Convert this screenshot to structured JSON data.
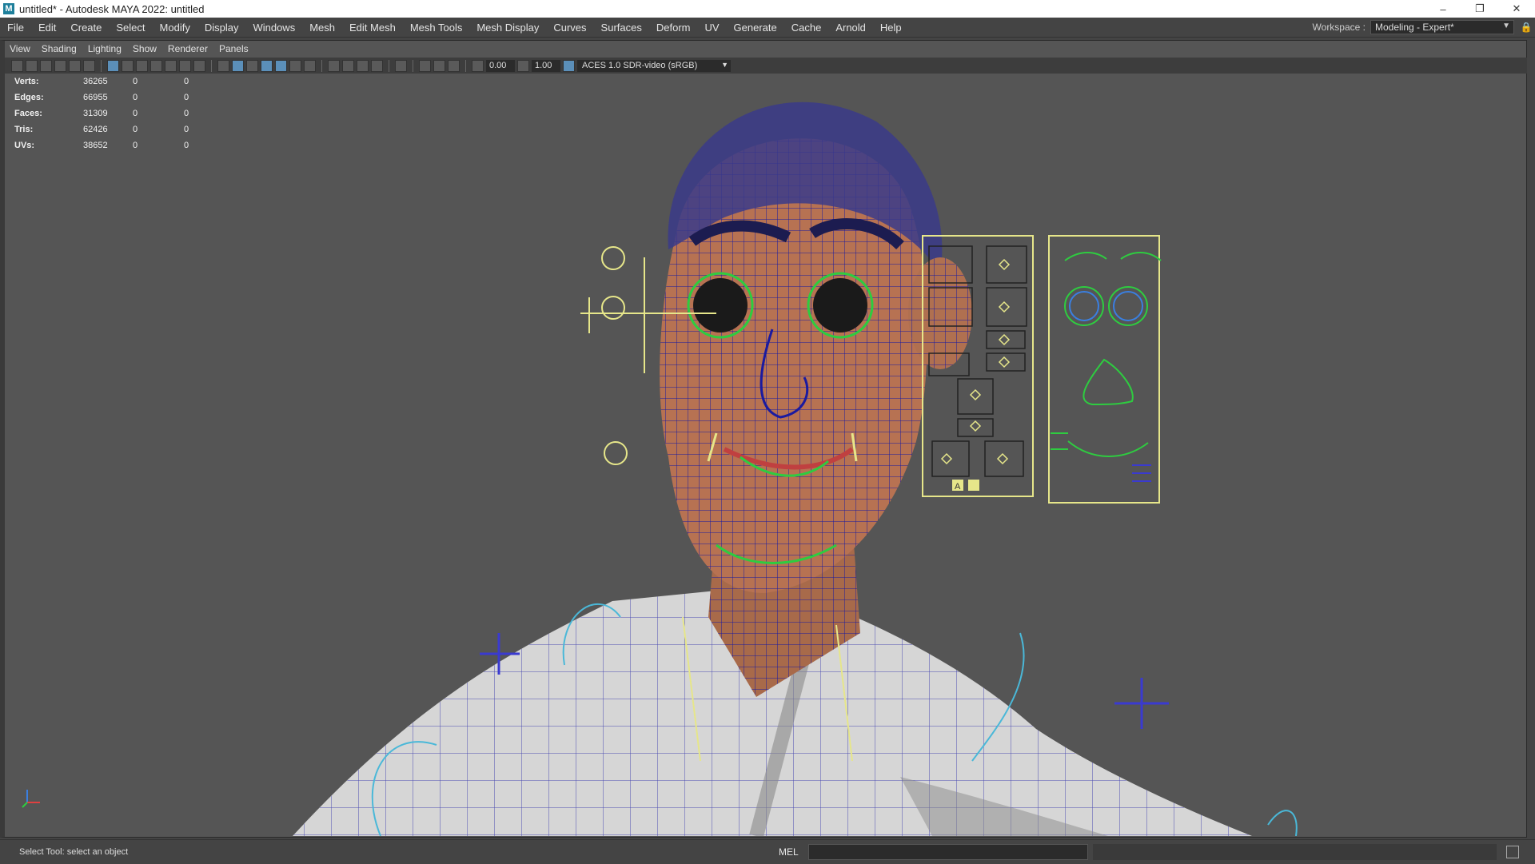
{
  "window": {
    "title": "untitled* - Autodesk MAYA 2022: untitled",
    "app_icon": "M",
    "controls": [
      "–",
      "❐",
      "✕"
    ]
  },
  "menubar": {
    "items": [
      "File",
      "Edit",
      "Create",
      "Select",
      "Modify",
      "Display",
      "Windows",
      "Mesh",
      "Edit Mesh",
      "Mesh Tools",
      "Mesh Display",
      "Curves",
      "Surfaces",
      "Deform",
      "UV",
      "Generate",
      "Cache",
      "Arnold",
      "Help"
    ]
  },
  "workspace": {
    "label": "Workspace :",
    "value": "Modeling - Expert*"
  },
  "panel": {
    "menus": [
      "View",
      "Shading",
      "Lighting",
      "Show",
      "Renderer",
      "Panels"
    ],
    "exposure": "0.00",
    "gamma": "1.00",
    "color_management": "ACES 1.0 SDR-video (sRGB)"
  },
  "hud": [
    {
      "label": "Verts:",
      "v1": "36265",
      "v2": "0",
      "v3": "0"
    },
    {
      "label": "Edges:",
      "v1": "66955",
      "v2": "0",
      "v3": "0"
    },
    {
      "label": "Faces:",
      "v1": "31309",
      "v2": "0",
      "v3": "0"
    },
    {
      "label": "Tris:",
      "v1": "62426",
      "v2": "0",
      "v3": "0"
    },
    {
      "label": "UVs:",
      "v1": "38652",
      "v2": "0",
      "v3": "0"
    }
  ],
  "picker": {
    "button_a": "A"
  },
  "status": {
    "message": "Select Tool: select an object",
    "script_type": "MEL"
  },
  "colors": {
    "viewport_bg": "#555555",
    "wire": "#1a1aa0",
    "skin": "#b07050",
    "shirt": "#d8d8d8",
    "control_yellow": "#e6e68a",
    "control_green": "#2ecc40",
    "control_blue": "#3a7fe0"
  }
}
